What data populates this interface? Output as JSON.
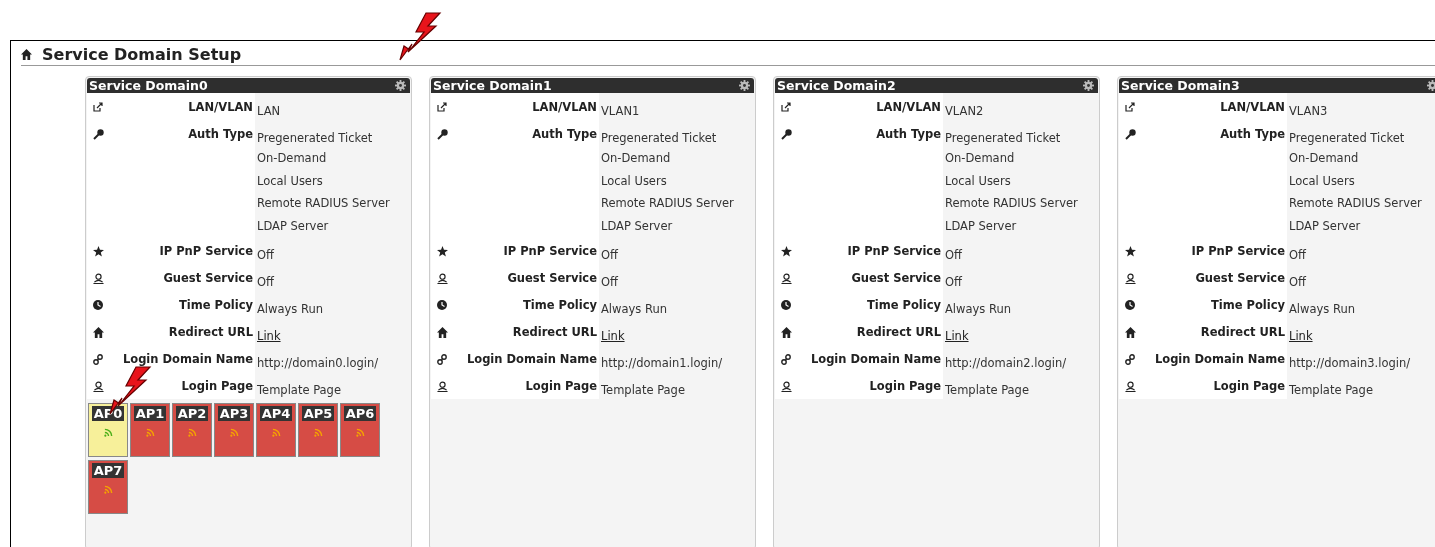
{
  "page": {
    "title": "Service Domain Setup"
  },
  "domains": [
    {
      "title": "Service Domain0",
      "rows": [
        {
          "kind": "text",
          "label": "LAN/VLAN",
          "values": [
            "LAN"
          ]
        },
        {
          "kind": "text",
          "label": "Auth Type",
          "values": [
            "Pregenerated Ticket",
            "On-Demand",
            "Local Users",
            "Remote RADIUS Server",
            "LDAP Server"
          ]
        },
        {
          "kind": "text",
          "label": "IP PnP Service",
          "values": [
            "Off"
          ]
        },
        {
          "kind": "text",
          "label": "Guest Service",
          "values": [
            "Off"
          ]
        },
        {
          "kind": "text",
          "label": "Time Policy",
          "values": [
            "Always Run"
          ]
        },
        {
          "kind": "link",
          "label": "Redirect URL",
          "values": [
            "Link"
          ]
        },
        {
          "kind": "text",
          "label": "Login Domain Name",
          "values": [
            "http://domain0.login/"
          ]
        },
        {
          "kind": "text",
          "label": "Login Page",
          "values": [
            "Template Page"
          ]
        }
      ],
      "aps": [
        {
          "label": "AP0",
          "online": true
        },
        {
          "label": "AP1",
          "online": false
        },
        {
          "label": "AP2",
          "online": false
        },
        {
          "label": "AP3",
          "online": false
        },
        {
          "label": "AP4",
          "online": false
        },
        {
          "label": "AP5",
          "online": false
        },
        {
          "label": "AP6",
          "online": false
        },
        {
          "label": "AP7",
          "online": false
        }
      ]
    },
    {
      "title": "Service Domain1",
      "rows": [
        {
          "kind": "text",
          "label": "LAN/VLAN",
          "values": [
            "VLAN1"
          ]
        },
        {
          "kind": "text",
          "label": "Auth Type",
          "values": [
            "Pregenerated Ticket",
            "On-Demand",
            "Local Users",
            "Remote RADIUS Server",
            "LDAP Server"
          ]
        },
        {
          "kind": "text",
          "label": "IP PnP Service",
          "values": [
            "Off"
          ]
        },
        {
          "kind": "text",
          "label": "Guest Service",
          "values": [
            "Off"
          ]
        },
        {
          "kind": "text",
          "label": "Time Policy",
          "values": [
            "Always Run"
          ]
        },
        {
          "kind": "link",
          "label": "Redirect URL",
          "values": [
            "Link"
          ]
        },
        {
          "kind": "text",
          "label": "Login Domain Name",
          "values": [
            "http://domain1.login/"
          ]
        },
        {
          "kind": "text",
          "label": "Login Page",
          "values": [
            "Template Page"
          ]
        }
      ]
    },
    {
      "title": "Service Domain2",
      "rows": [
        {
          "kind": "text",
          "label": "LAN/VLAN",
          "values": [
            "VLAN2"
          ]
        },
        {
          "kind": "text",
          "label": "Auth Type",
          "values": [
            "Pregenerated Ticket",
            "On-Demand",
            "Local Users",
            "Remote RADIUS Server",
            "LDAP Server"
          ]
        },
        {
          "kind": "text",
          "label": "IP PnP Service",
          "values": [
            "Off"
          ]
        },
        {
          "kind": "text",
          "label": "Guest Service",
          "values": [
            "Off"
          ]
        },
        {
          "kind": "text",
          "label": "Time Policy",
          "values": [
            "Always Run"
          ]
        },
        {
          "kind": "link",
          "label": "Redirect URL",
          "values": [
            "Link"
          ]
        },
        {
          "kind": "text",
          "label": "Login Domain Name",
          "values": [
            "http://domain2.login/"
          ]
        },
        {
          "kind": "text",
          "label": "Login Page",
          "values": [
            "Template Page"
          ]
        }
      ]
    },
    {
      "title": "Service Domain3",
      "rows": [
        {
          "kind": "text",
          "label": "LAN/VLAN",
          "values": [
            "VLAN3"
          ]
        },
        {
          "kind": "text",
          "label": "Auth Type",
          "values": [
            "Pregenerated Ticket",
            "On-Demand",
            "Local Users",
            "Remote RADIUS Server",
            "LDAP Server"
          ]
        },
        {
          "kind": "text",
          "label": "IP PnP Service",
          "values": [
            "Off"
          ]
        },
        {
          "kind": "text",
          "label": "Guest Service",
          "values": [
            "Off"
          ]
        },
        {
          "kind": "text",
          "label": "Time Policy",
          "values": [
            "Always Run"
          ]
        },
        {
          "kind": "link",
          "label": "Redirect URL",
          "values": [
            "Link"
          ]
        },
        {
          "kind": "text",
          "label": "Login Domain Name",
          "values": [
            "http://domain3.login/"
          ]
        },
        {
          "kind": "text",
          "label": "Login Page",
          "values": [
            "Template Page"
          ]
        }
      ]
    }
  ]
}
